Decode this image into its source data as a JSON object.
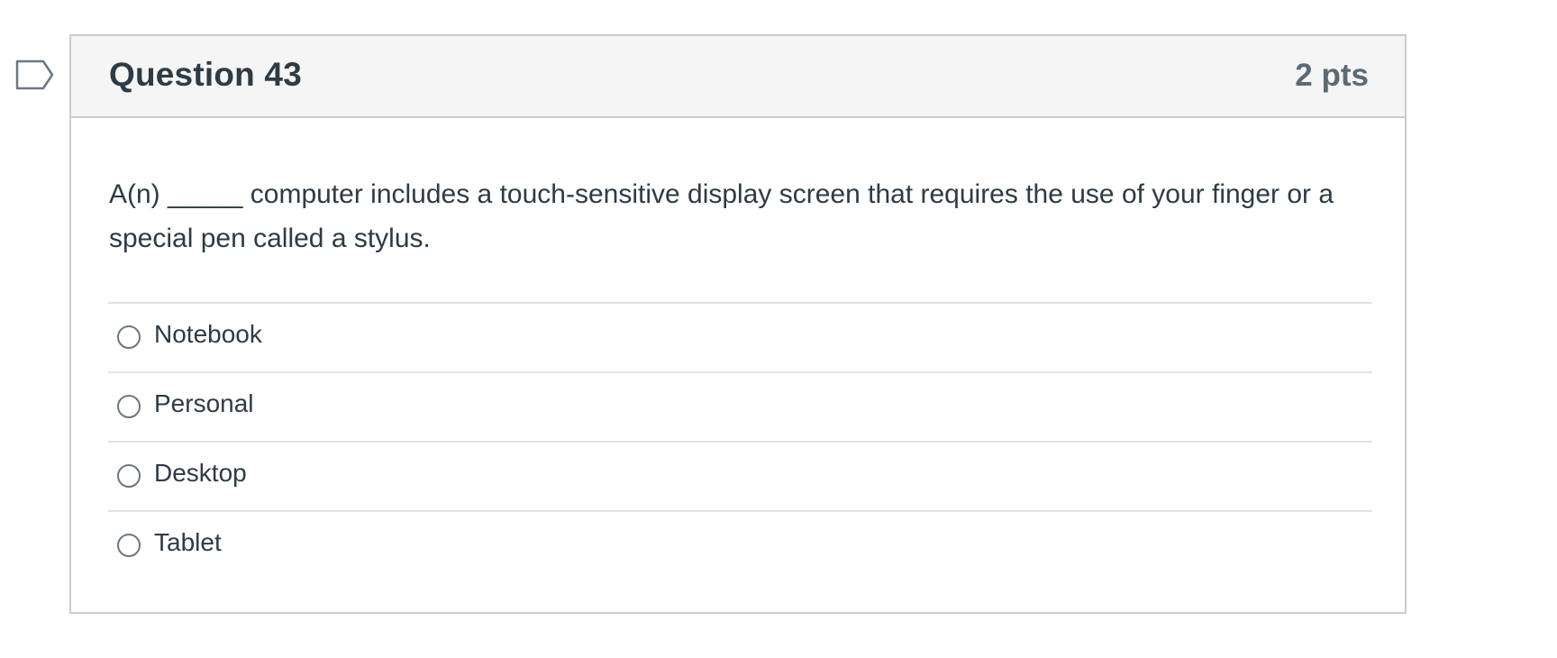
{
  "flag": {
    "icon": "flag-question-icon",
    "color": "#6a7883"
  },
  "question": {
    "title": "Question 43",
    "points": "2 pts",
    "text": "A(n) _____ computer includes a touch-sensitive display screen that requires the use of your finger or a special pen called a stylus.",
    "answers": [
      {
        "label": "Notebook",
        "selected": false
      },
      {
        "label": "Personal",
        "selected": false
      },
      {
        "label": "Desktop",
        "selected": false
      },
      {
        "label": "Tablet",
        "selected": false
      }
    ]
  },
  "colors": {
    "text": "#2d3b45",
    "points": "#5b6a75",
    "header_bg": "#f5f5f5",
    "border": "#c7cdd1",
    "divider": "#dfe3e6"
  }
}
